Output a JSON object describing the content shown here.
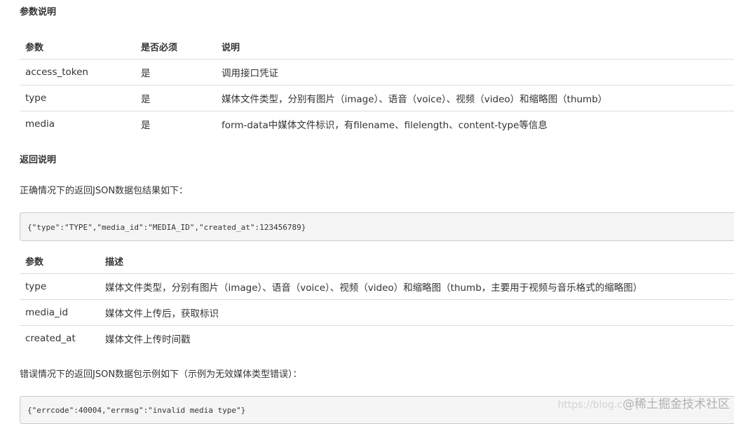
{
  "params_section": {
    "heading": "参数说明",
    "columns": [
      "参数",
      "是否必须",
      "说明"
    ],
    "rows": [
      [
        "access_token",
        "是",
        "调用接口凭证"
      ],
      [
        "type",
        "是",
        "媒体文件类型，分别有图片（image）、语音（voice）、视频（video）和缩略图（thumb）"
      ],
      [
        "media",
        "是",
        "form-data中媒体文件标识，有filename、filelength、content-type等信息"
      ]
    ]
  },
  "return_section": {
    "heading": "返回说明",
    "success_text": "正确情况下的返回JSON数据包结果如下：",
    "success_code": "{\"type\":\"TYPE\",\"media_id\":\"MEDIA_ID\",\"created_at\":123456789}",
    "columns": [
      "参数",
      "描述"
    ],
    "rows": [
      [
        "type",
        "媒体文件类型，分别有图片（image）、语音（voice）、视频（video）和缩略图（thumb，主要用于视频与音乐格式的缩略图）"
      ],
      [
        "media_id",
        "媒体文件上传后，获取标识"
      ],
      [
        "created_at",
        "媒体文件上传时间戳"
      ]
    ],
    "error_text": "错误情况下的返回JSON数据包示例如下（示例为无效媒体类型错误）：",
    "error_code": "{\"errcode\":40004,\"errmsg\":\"invalid media type\"}"
  },
  "watermark": {
    "url": "https://blog.c",
    "label": "@稀土掘金技术社区"
  }
}
